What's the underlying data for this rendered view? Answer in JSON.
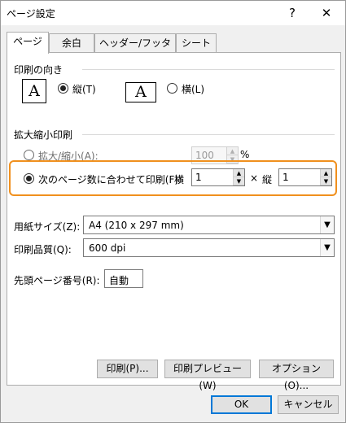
{
  "window": {
    "title": "ページ設定",
    "help_label": "?",
    "close_label": "✕"
  },
  "tabs": [
    {
      "label": "ページ",
      "active": true
    },
    {
      "label": "余白",
      "active": false
    },
    {
      "label": "ヘッダー/フッター",
      "active": false
    },
    {
      "label": "シート",
      "active": false
    }
  ],
  "orientation": {
    "section_label": "印刷の向き",
    "portrait": {
      "icon_glyph": "A",
      "label": "縦(T)",
      "selected": true
    },
    "landscape": {
      "icon_glyph": "A",
      "label": "横(L)",
      "selected": false
    }
  },
  "scaling": {
    "section_label": "拡大縮小印刷",
    "adjust": {
      "label": "拡大/縮小(A):",
      "value": "100",
      "unit": "%",
      "selected": false
    },
    "fit": {
      "label": "次のページ数に合わせて印刷(F):",
      "wide_label": "横",
      "wide_value": "1",
      "times": "×",
      "tall_label": "縦",
      "tall_value": "1",
      "selected": true
    }
  },
  "paper": {
    "size_label": "用紙サイズ(Z):",
    "size_value": "A4 (210 x 297 mm)",
    "quality_label": "印刷品質(Q):",
    "quality_value": "600 dpi",
    "first_page_label": "先頭ページ番号(R):",
    "first_page_value": "自動"
  },
  "actions": {
    "print": "印刷(P)...",
    "preview": "印刷プレビュー(W)",
    "options": "オプション(O)...",
    "ok": "OK",
    "cancel": "キャンセル"
  },
  "colors": {
    "highlight": "#f0901e",
    "default_button_border": "#0078d7"
  },
  "icons": [
    "portrait-orientation-icon",
    "landscape-orientation-icon",
    "spin-up-icon",
    "spin-down-icon",
    "dropdown-arrow-icon"
  ]
}
